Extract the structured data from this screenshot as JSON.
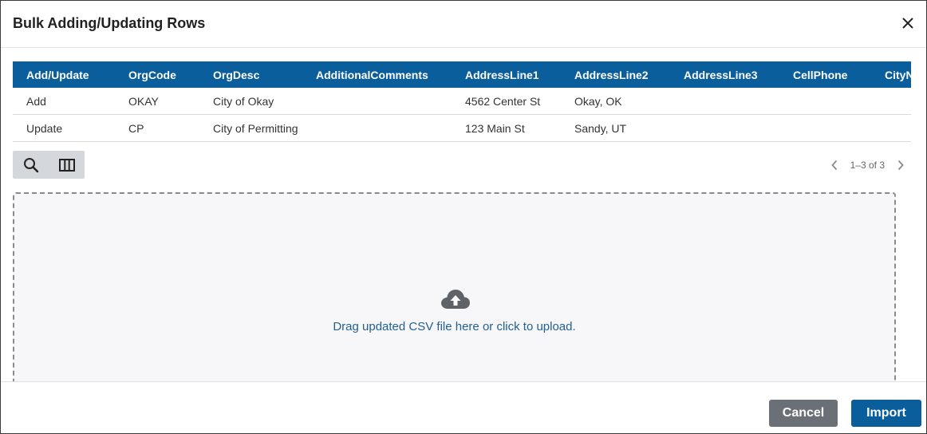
{
  "dialog": {
    "title": "Bulk Adding/Updating Rows"
  },
  "grid": {
    "columns": [
      "Add/Update",
      "OrgCode",
      "OrgDesc",
      "AdditionalComments",
      "AddressLine1",
      "AddressLine2",
      "AddressLine3",
      "CellPhone",
      "CityName"
    ],
    "rows": [
      [
        "Add",
        "OKAY",
        "City of Okay",
        "",
        "4562 Center St",
        "Okay, OK",
        "",
        "",
        ""
      ],
      [
        "Update",
        "CP",
        "City of Permitting",
        "",
        "123 Main St",
        "Sandy, UT",
        "",
        "",
        ""
      ]
    ]
  },
  "toolbar": {
    "search_icon": "search-icon",
    "columns_icon": "columns-icon"
  },
  "pager": {
    "range": "1–3 of 3"
  },
  "dropzone": {
    "text": "Drag updated CSV file here or click to upload.",
    "icon": "cloud-upload-icon"
  },
  "footer": {
    "cancel_label": "Cancel",
    "import_label": "Import"
  },
  "colors": {
    "header_blue": "#0b5e9c",
    "cancel_gray": "#6b7077",
    "link_blue": "#22608f"
  }
}
